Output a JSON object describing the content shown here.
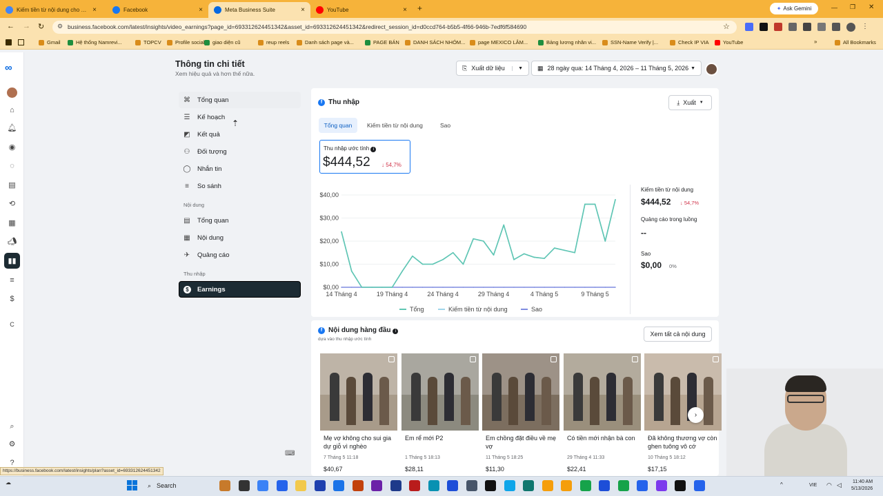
{
  "browser": {
    "tabs": [
      {
        "title": "Kiếm tiền từ nội dung cho các",
        "color": "#4285f4",
        "icon": "google-icon"
      },
      {
        "title": "Facebook",
        "color": "#1877f2",
        "icon": "facebook-icon"
      },
      {
        "title": "Meta Business Suite",
        "color": "#0668e1",
        "icon": "meta-icon"
      },
      {
        "title": "YouTube",
        "color": "#ff0000",
        "icon": "youtube-icon"
      }
    ],
    "ask_gemini": "Ask Gemini",
    "url": "business.facebook.com/latest/insights/video_earnings?page_id=693312624451342&asset_id=693312624451342&redirect_session_id=d0ccd764-b5b5-4f66-946b-7edf6f584690",
    "bookmarks": [
      "Gmail",
      "Hệ thống Namrevi...",
      "TOPCV",
      "Profile social",
      "giao diện cũ",
      "reup reels",
      "Danh sách page và...",
      "PAGE BÁN",
      "DANH SÁCH NHÓM...",
      "page MEXICO LÂM...",
      "Bảng lương nhân vi...",
      "SSN-Name Verify |...",
      "Check IP VIA",
      "YouTube"
    ],
    "all_bookmarks": "All Bookmarks",
    "status_url": "https://business.facebook.com/latest/insights/plan?asset_id=693312624451342"
  },
  "header": {
    "title": "Thông tin chi tiết",
    "subtitle": "Xem hiệu quả và hơn thế nữa.",
    "export_data": "Xuất dữ liệu",
    "date_range": "28 ngày qua: 14 Tháng 4, 2026 – 11 Tháng 5, 2026"
  },
  "menu": {
    "items": [
      {
        "label": "Tổng quan",
        "icon": "overview-icon",
        "glyph": "⌘"
      },
      {
        "label": "Kế hoạch",
        "icon": "plan-icon",
        "glyph": "☰"
      },
      {
        "label": "Kết quả",
        "icon": "results-icon",
        "glyph": "◩"
      },
      {
        "label": "Đối tượng",
        "icon": "audience-icon",
        "glyph": "⚇"
      },
      {
        "label": "Nhắn tin",
        "icon": "messages-icon",
        "glyph": "◯"
      },
      {
        "label": "So sánh",
        "icon": "compare-icon",
        "glyph": "≡"
      }
    ],
    "section_content": "Nội dung",
    "content_items": [
      {
        "label": "Tổng quan",
        "icon": "content-overview-icon",
        "glyph": "▤"
      },
      {
        "label": "Nội dung",
        "icon": "content-icon",
        "glyph": "▦"
      },
      {
        "label": "Quảng cáo",
        "icon": "ads-icon",
        "glyph": "✈"
      }
    ],
    "section_income": "Thu nhập",
    "earnings": {
      "label": "Earnings",
      "icon": "earnings-icon",
      "glyph": "$"
    }
  },
  "earnings_card": {
    "title": "Thu nhập",
    "export": "Xuất",
    "tabs": [
      "Tổng quan",
      "Kiếm tiền từ nội dung",
      "Sao"
    ],
    "estimated_label": "Thu nhập ước tính",
    "estimated_value": "$444,52",
    "estimated_change": "↓ 54,7%",
    "side": {
      "cm_label": "Kiếm tiền từ nội dung",
      "cm_value": "$444,52",
      "cm_change": "↓ 54,7%",
      "instream_label": "Quảng cáo trong luồng",
      "instream_value": "--",
      "stars_label": "Sao",
      "stars_value": "$0,00",
      "stars_change": "0%"
    }
  },
  "chart_data": {
    "type": "line",
    "title": "",
    "xlabel": "",
    "ylabel": "",
    "x_ticks": [
      "14 Tháng 4",
      "19 Tháng 4",
      "24 Tháng 4",
      "29 Tháng 4",
      "4 Tháng 5",
      "9 Tháng 5"
    ],
    "y_ticks": [
      "$0,00",
      "$10,00",
      "$20,00",
      "$30,00",
      "$40,00"
    ],
    "ylim": [
      0,
      40
    ],
    "x": [
      "14/4",
      "15/4",
      "16/4",
      "17/4",
      "18/4",
      "19/4",
      "20/4",
      "21/4",
      "22/4",
      "23/4",
      "24/4",
      "25/4",
      "26/4",
      "27/4",
      "28/4",
      "29/4",
      "30/4",
      "1/5",
      "2/5",
      "3/5",
      "4/5",
      "5/5",
      "6/5",
      "7/5",
      "8/5",
      "9/5",
      "10/5",
      "11/5"
    ],
    "series": [
      {
        "name": "Tổng",
        "color": "#5fc6b2",
        "values": [
          24,
          7,
          0,
          0,
          0,
          0,
          7,
          13.5,
          10,
          10,
          12,
          15,
          10,
          21,
          20,
          14,
          27,
          12,
          14.5,
          13,
          12.5,
          17,
          16,
          15,
          36,
          36,
          20,
          38
        ]
      },
      {
        "name": "Kiếm tiền từ nội dung",
        "color": "#9fd5ea",
        "values": [
          24,
          7,
          0,
          0,
          0,
          0,
          7,
          13.5,
          10,
          10,
          12,
          15,
          10,
          21,
          20,
          14,
          27,
          12,
          14.5,
          13,
          12.5,
          17,
          16,
          15,
          36,
          36,
          20,
          38
        ]
      },
      {
        "name": "Sao",
        "color": "#7f8ce0",
        "values": [
          0,
          0,
          0,
          0,
          0,
          0,
          0,
          0,
          0,
          0,
          0,
          0,
          0,
          0,
          0,
          0,
          0,
          0,
          0,
          0,
          0,
          0,
          0,
          0,
          0,
          0,
          0,
          0
        ]
      }
    ],
    "legend": "bottom"
  },
  "top_content": {
    "title": "Nội dung hàng đầu",
    "subtitle": "dựa vào thu nhập ước tính",
    "see_all": "Xem tất cả nội dung",
    "items": [
      {
        "caption": "Mẹ vợ không cho sui gia dự giỗ vì nghèo",
        "date": "7 Tháng 5 11:18",
        "amount": "$40,67",
        "bg": "#a89b8a"
      },
      {
        "caption": "Em rể mới P2",
        "date": "1 Tháng 5 18:13",
        "amount": "$28,11",
        "bg": "#8c8a7f"
      },
      {
        "caption": "Em chồng đặt điều về mẹ vợ",
        "date": "11 Tháng 5 18:25",
        "amount": "$11,30",
        "bg": "#7c6e5f"
      },
      {
        "caption": "Có tiền mới nhận bà con",
        "date": "29 Tháng 4 11:33",
        "amount": "$22,41",
        "bg": "#9a8f7c"
      },
      {
        "caption": "Đã không thương vợ còn ghen tuông vô cớ",
        "date": "10 Tháng 5 18:12",
        "amount": "$17,15",
        "bg": "#b7a591"
      }
    ]
  },
  "taskbar": {
    "search": "Search",
    "lang": "VIE",
    "time": "11:40 AM",
    "date": "5/13/2026"
  }
}
